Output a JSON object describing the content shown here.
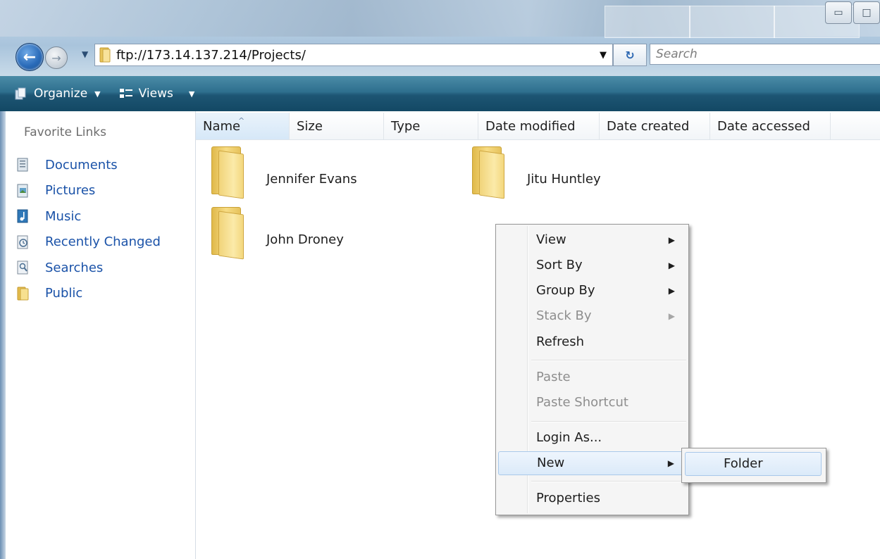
{
  "window": {
    "minimize_glyph": "▭",
    "maximize_glyph": "□"
  },
  "address_bar": {
    "path": "ftp://173.14.137.214/Projects/",
    "search_placeholder": "Search"
  },
  "command_bar": {
    "organize_label": "Organize",
    "views_label": "Views"
  },
  "nav_pane": {
    "title": "Favorite Links",
    "links": [
      {
        "label": "Documents",
        "icon": "documents-icon"
      },
      {
        "label": "Pictures",
        "icon": "pictures-icon"
      },
      {
        "label": "Music",
        "icon": "music-icon"
      },
      {
        "label": "Recently Changed",
        "icon": "recently-changed-icon"
      },
      {
        "label": "Searches",
        "icon": "searches-icon"
      },
      {
        "label": "Public",
        "icon": "public-folder-icon"
      }
    ]
  },
  "columns": [
    "Name",
    "Size",
    "Type",
    "Date modified",
    "Date created",
    "Date accessed"
  ],
  "files": [
    {
      "name": "Jennifer Evans",
      "type": "folder"
    },
    {
      "name": "Jitu Huntley",
      "type": "folder"
    },
    {
      "name": "John Droney",
      "type": "folder"
    }
  ],
  "context_menu": {
    "items": [
      {
        "label": "View",
        "submenu": true,
        "disabled": false
      },
      {
        "label": "Sort By",
        "submenu": true,
        "disabled": false
      },
      {
        "label": "Group By",
        "submenu": true,
        "disabled": false
      },
      {
        "label": "Stack By",
        "submenu": true,
        "disabled": true
      },
      {
        "label": "Refresh",
        "submenu": false,
        "disabled": false
      },
      {
        "label": "Paste",
        "submenu": false,
        "disabled": true
      },
      {
        "label": "Paste Shortcut",
        "submenu": false,
        "disabled": true
      },
      {
        "label": "Login As...",
        "submenu": false,
        "disabled": false
      },
      {
        "label": "New",
        "submenu": true,
        "disabled": false,
        "highlighted": true
      },
      {
        "label": "Properties",
        "submenu": false,
        "disabled": false
      }
    ],
    "new_submenu": [
      "Folder"
    ]
  },
  "colors": {
    "link_blue": "#1a52a8",
    "cmdbar_dark": "#134864",
    "menu_highlight": "#dbeaf9"
  }
}
